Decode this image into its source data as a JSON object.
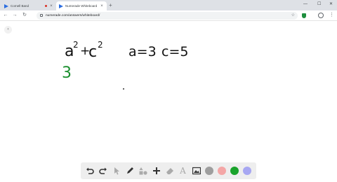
{
  "browser": {
    "tabs": [
      {
        "title": "Cornell Band",
        "active": false
      },
      {
        "title": "Numerade Whiteboard",
        "active": true
      }
    ],
    "new_tab_label": "+",
    "url": "numerade.com/answers/whiteboard/"
  },
  "whiteboard": {
    "strokes": {
      "a": "a",
      "exp1": "2",
      "plus": "+",
      "c": "c",
      "exp2": "2",
      "a_eq": "a=3",
      "c_eq": "c=5",
      "green_3": "3"
    }
  },
  "toolbar": {
    "tools": [
      "undo-icon",
      "redo-icon",
      "pointer-icon",
      "pen-icon",
      "shapes-icon",
      "move-icon",
      "eraser-icon",
      "text-icon",
      "image-icon"
    ],
    "colors": [
      "#9e9e9e",
      "#f4a6a6",
      "#1aa32c",
      "#a7a7f2"
    ]
  }
}
